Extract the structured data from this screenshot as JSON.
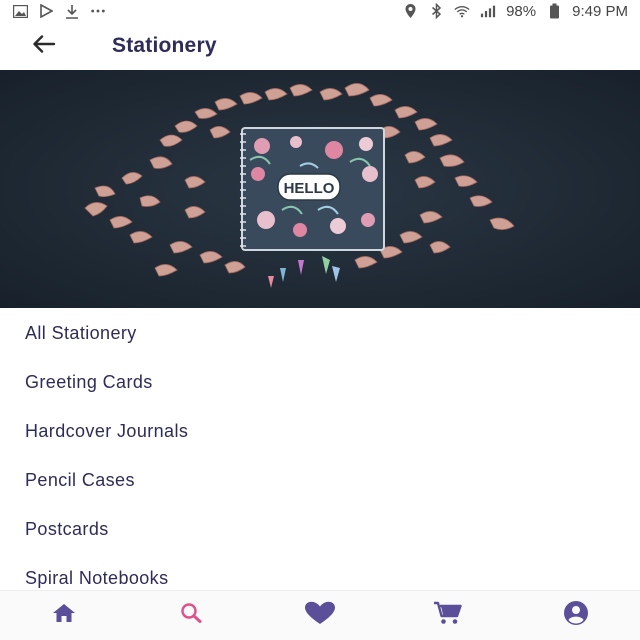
{
  "status_bar": {
    "left_icons": [
      "image-icon",
      "play-store-icon",
      "download-icon",
      "more-dots-icon"
    ],
    "right_icons": [
      "location-icon",
      "bluetooth-icon",
      "wifi-icon",
      "signal-icon",
      "battery-icon"
    ],
    "battery": "98%",
    "time": "9:49 PM"
  },
  "app_bar": {
    "title": "Stationery",
    "back_icon": "arrow-back-icon"
  },
  "hero": {
    "notebook_text": "HELLO"
  },
  "categories": [
    {
      "label": "All Stationery"
    },
    {
      "label": "Greeting Cards"
    },
    {
      "label": "Hardcover Journals"
    },
    {
      "label": "Pencil Cases"
    },
    {
      "label": "Postcards"
    },
    {
      "label": "Spiral Notebooks"
    }
  ],
  "bottom_nav": {
    "items": [
      {
        "icon": "home-icon",
        "active": false
      },
      {
        "icon": "search-icon",
        "active": true
      },
      {
        "icon": "heart-icon",
        "active": false
      },
      {
        "icon": "cart-icon",
        "active": false
      },
      {
        "icon": "account-icon",
        "active": false
      }
    ]
  },
  "colors": {
    "text_primary": "#2e2c58",
    "nav_icon": "#5b4f9a",
    "nav_active": "#e0508a",
    "hero_bg": "#1f2a36"
  }
}
